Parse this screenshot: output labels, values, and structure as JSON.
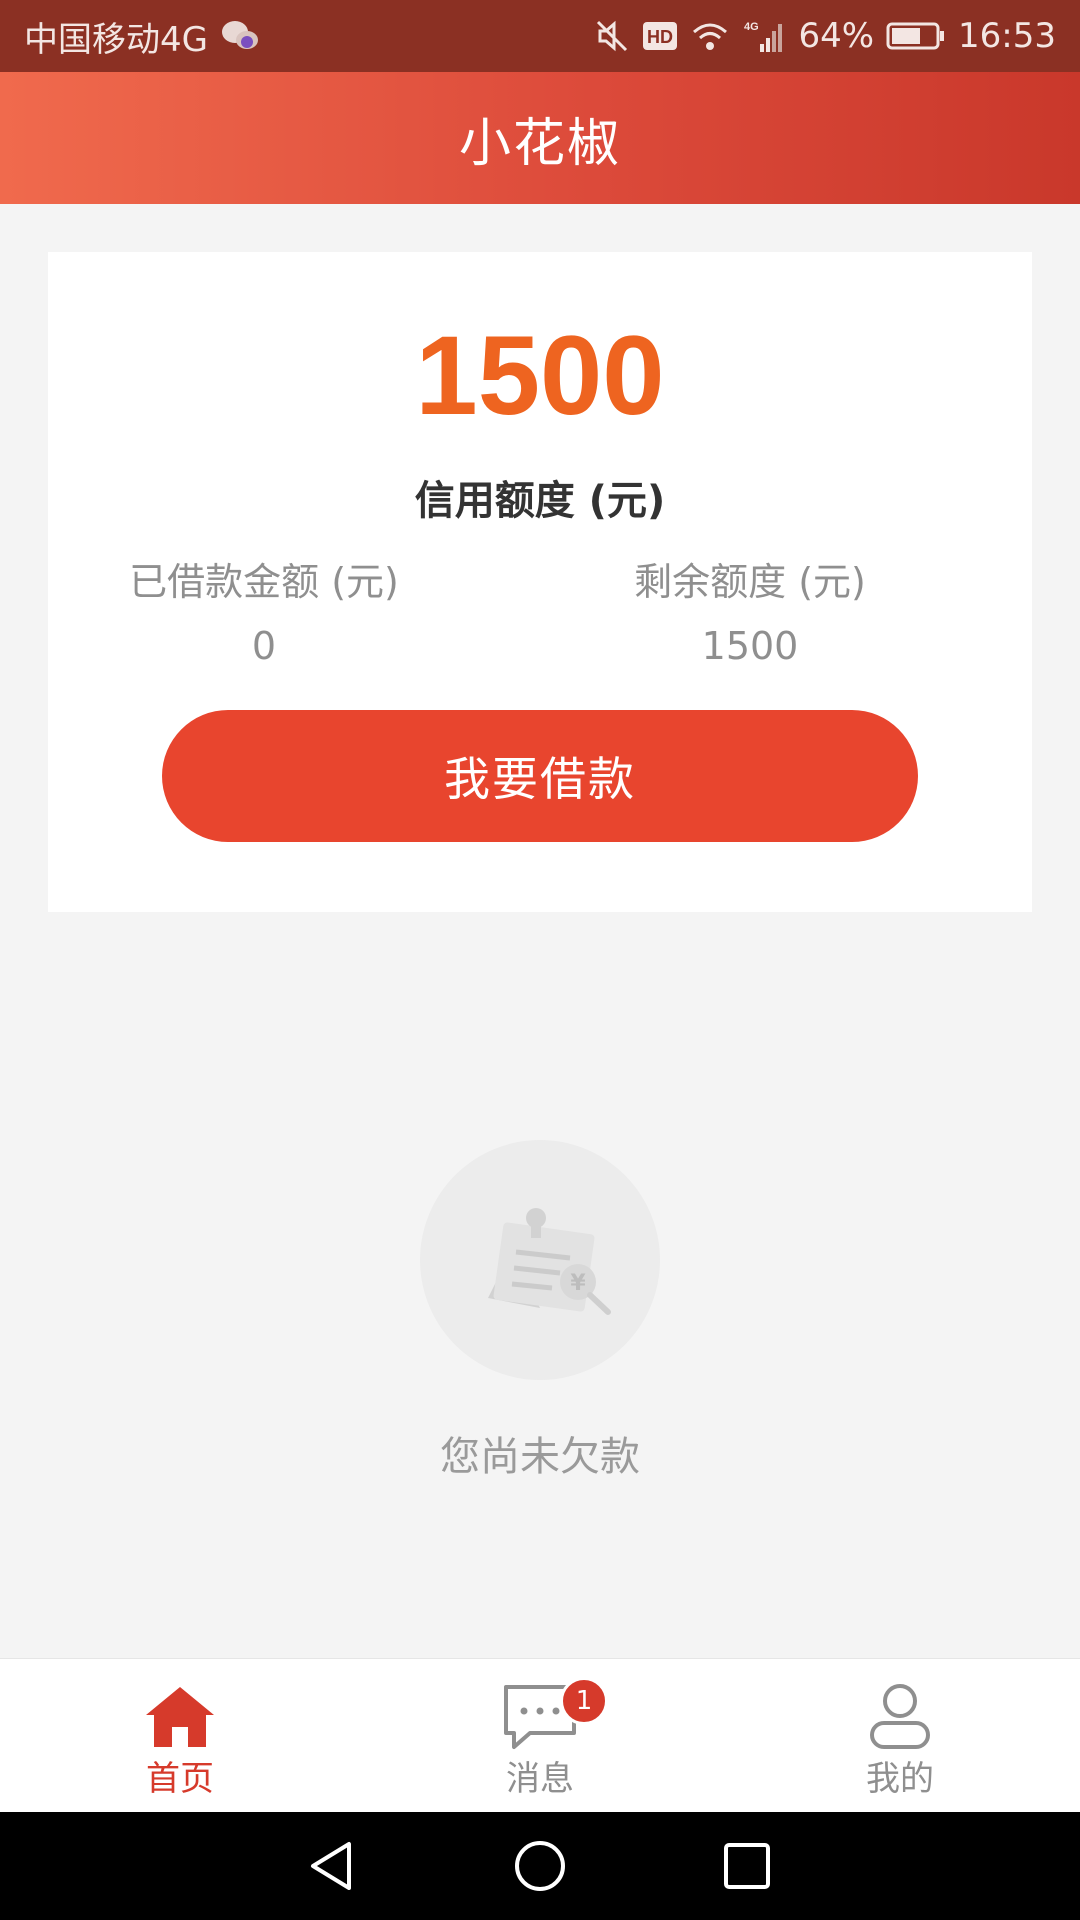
{
  "status_bar": {
    "carrier": "中国移动4G",
    "battery": "64%",
    "time": "16:53",
    "hd_label": "HD",
    "network_label": "4G"
  },
  "header": {
    "title": "小花椒"
  },
  "credit": {
    "amount": "1500",
    "label": "信用额度 (元)",
    "borrowed_label": "已借款金额 (元)",
    "borrowed_value": "0",
    "remaining_label": "剩余额度 (元)",
    "remaining_value": "1500",
    "borrow_button": "我要借款"
  },
  "empty_state": {
    "text": "您尚未欠款"
  },
  "bottom_nav": {
    "items": [
      {
        "label": "首页",
        "icon": "home-icon",
        "active": true
      },
      {
        "label": "消息",
        "icon": "message-icon",
        "badge": "1"
      },
      {
        "label": "我的",
        "icon": "profile-icon"
      }
    ]
  },
  "colors": {
    "accent": "#e8452e",
    "amount": "#ee6420",
    "status_bar": "#8b3023"
  }
}
